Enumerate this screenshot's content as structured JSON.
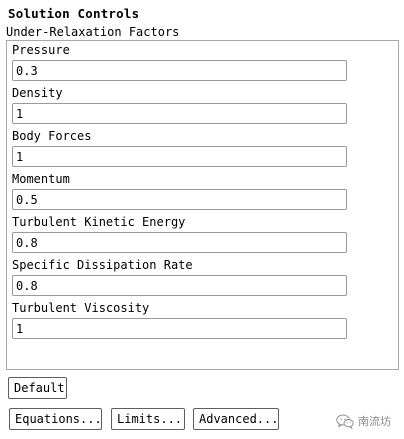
{
  "panel": {
    "title": "Solution Controls"
  },
  "under_relaxation": {
    "group_label": "Under-Relaxation Factors",
    "fields": [
      {
        "label": "Pressure",
        "value": "0.3"
      },
      {
        "label": "Density",
        "value": "1"
      },
      {
        "label": "Body Forces",
        "value": "1"
      },
      {
        "label": "Momentum",
        "value": "0.5"
      },
      {
        "label": "Turbulent Kinetic Energy",
        "value": "0.8"
      },
      {
        "label": "Specific Dissipation Rate",
        "value": "0.8"
      },
      {
        "label": "Turbulent Viscosity",
        "value": "1"
      }
    ]
  },
  "buttons": {
    "default": "Default",
    "equations": "Equations...",
    "limits": "Limits...",
    "advanced": "Advanced..."
  },
  "watermark": {
    "text": "南流坊",
    "icon": "wechat-logo-icon"
  }
}
